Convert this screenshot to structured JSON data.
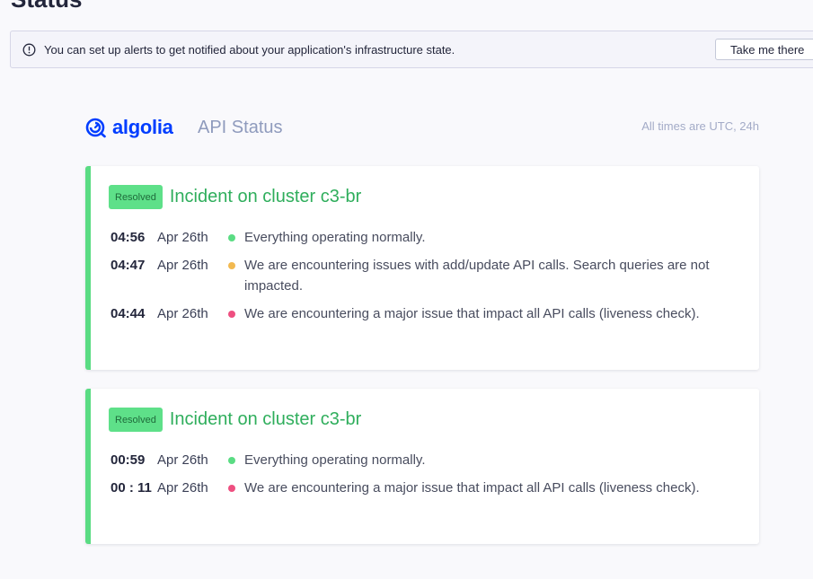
{
  "page": {
    "heading": "Status"
  },
  "alert_banner": {
    "icon": "info-icon",
    "message": "You can set up alerts to get notified about your application's infrastructure state.",
    "button_label": "Take me there"
  },
  "status_page": {
    "brand_name": "algolia",
    "brand_icon": "algolia-logo-icon",
    "title": "API Status",
    "timezone_note": "All times are UTC, 24h"
  },
  "colors": {
    "operational": "#5adc83",
    "degraded": "#f2b950",
    "major": "#ee4f80",
    "brand": "#003dff"
  },
  "incidents": [
    {
      "badge": "Resolved",
      "title": "Incident on cluster c3-br",
      "updates": [
        {
          "time": "04:56",
          "date": "Apr 26th",
          "status": "operational",
          "message": "Everything operating normally."
        },
        {
          "time": "04:47",
          "date": "Apr 26th",
          "status": "degraded",
          "message": "We are encountering issues with add/update API calls. Search queries are not impacted."
        },
        {
          "time": "04:44",
          "date": "Apr 26th",
          "status": "major",
          "message": "We are encountering a major issue that impact all API calls (liveness check)."
        }
      ]
    },
    {
      "badge": "Resolved",
      "title": "Incident on cluster c3-br",
      "updates": [
        {
          "time": "00:59",
          "date": "Apr 26th",
          "status": "operational",
          "message": "Everything operating normally."
        },
        {
          "time": "00 : 11",
          "date": "Apr 26th",
          "status": "major",
          "message": "We are encountering a major issue that impact all API calls (liveness check)."
        }
      ]
    }
  ]
}
